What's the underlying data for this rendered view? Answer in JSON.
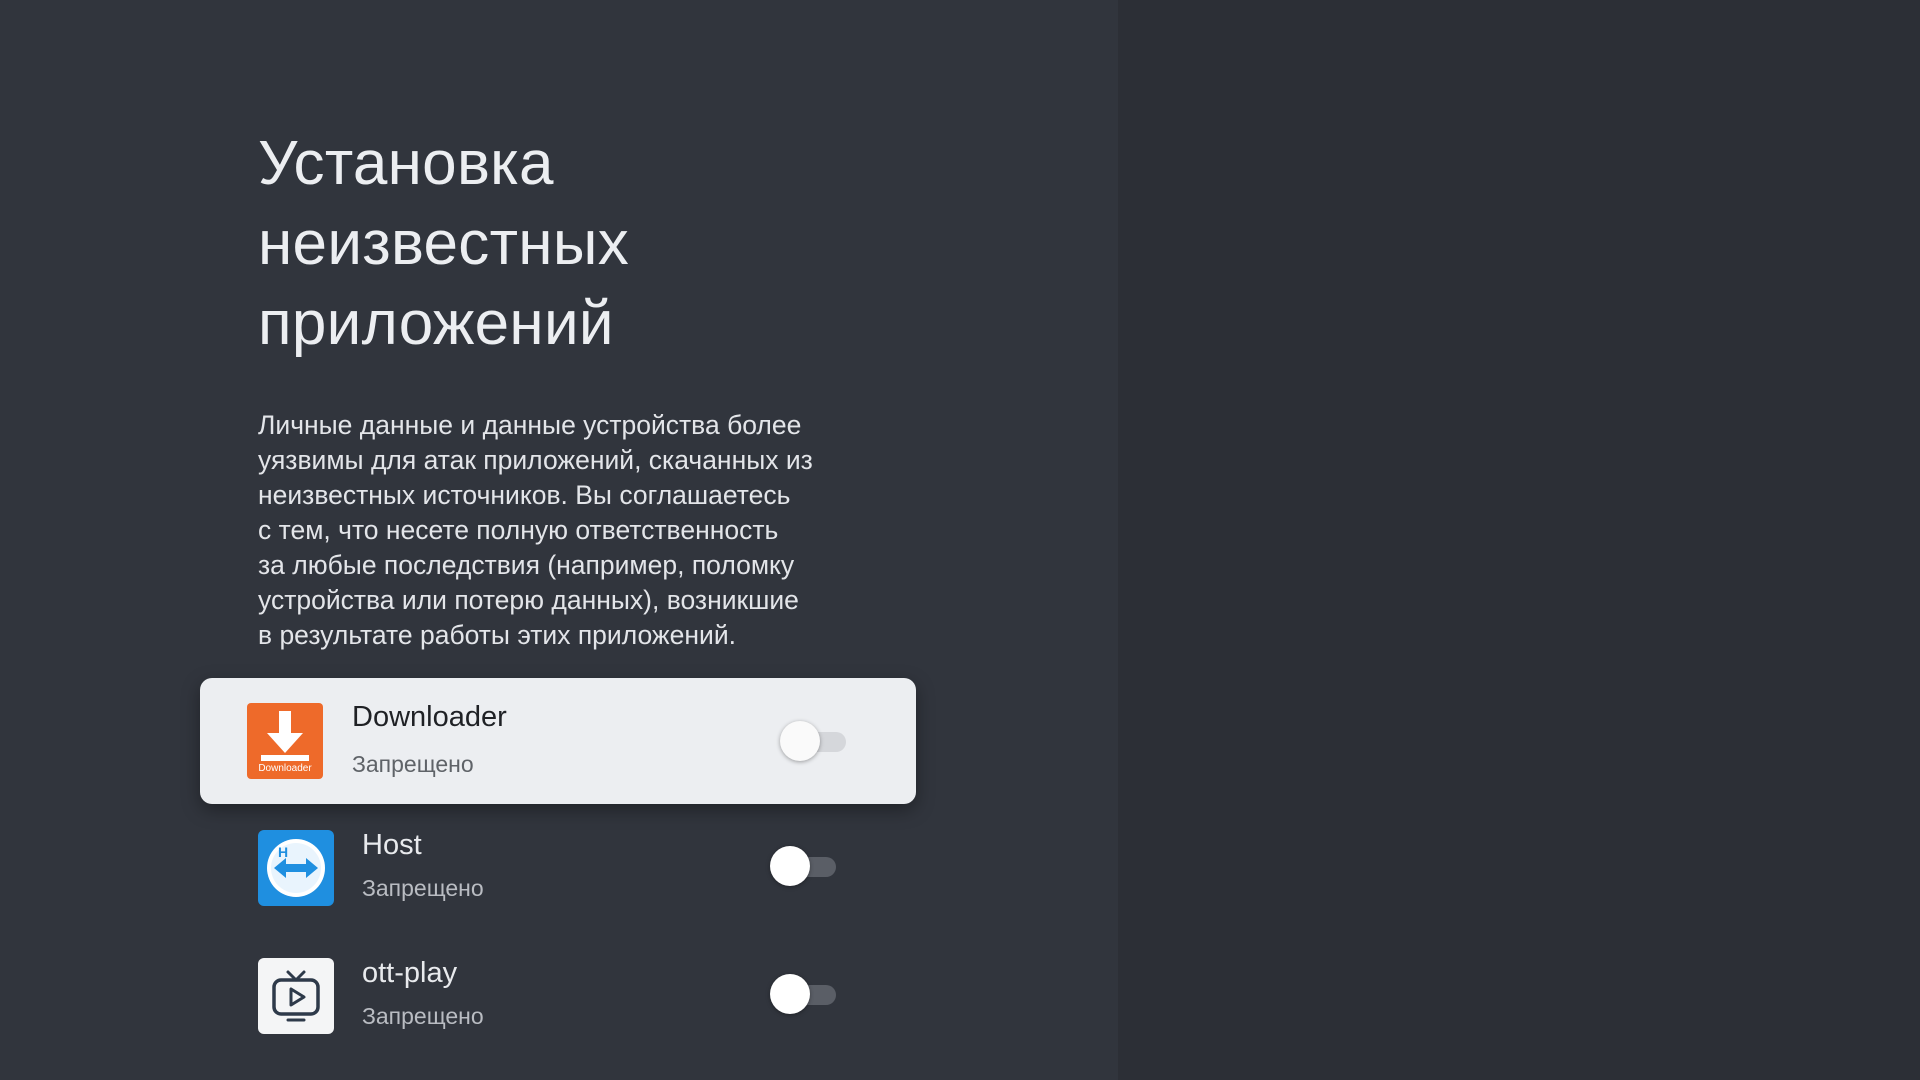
{
  "page": {
    "title_lines": [
      "Установка",
      "неизвестных",
      "приложений"
    ],
    "description_lines": [
      "Личные данные и данные устройства более",
      "уязвимы для атак приложений, скачанных из",
      "неизвестных источников. Вы соглашаетесь",
      "с тем, что несете полную ответственность",
      "за любые последствия (например, поломку",
      "устройства или потерю данных), возникшие",
      "в результате работы этих приложений."
    ]
  },
  "apps": [
    {
      "name": "Downloader",
      "status": "Запрещено",
      "icon": "downloader-icon",
      "icon_text": "Downloader",
      "enabled": false,
      "focused": true
    },
    {
      "name": "Host",
      "status": "Запрещено",
      "icon": "teamviewer-host-icon",
      "enabled": false,
      "focused": false
    },
    {
      "name": "ott-play",
      "status": "Запрещено",
      "icon": "ott-play-tv-icon",
      "enabled": false,
      "focused": false
    }
  ],
  "colors": {
    "background": "#31353d",
    "focused_row": "#eceef1",
    "downloader_brand": "#ee6a2a",
    "host_brand": "#1f8fe0"
  }
}
